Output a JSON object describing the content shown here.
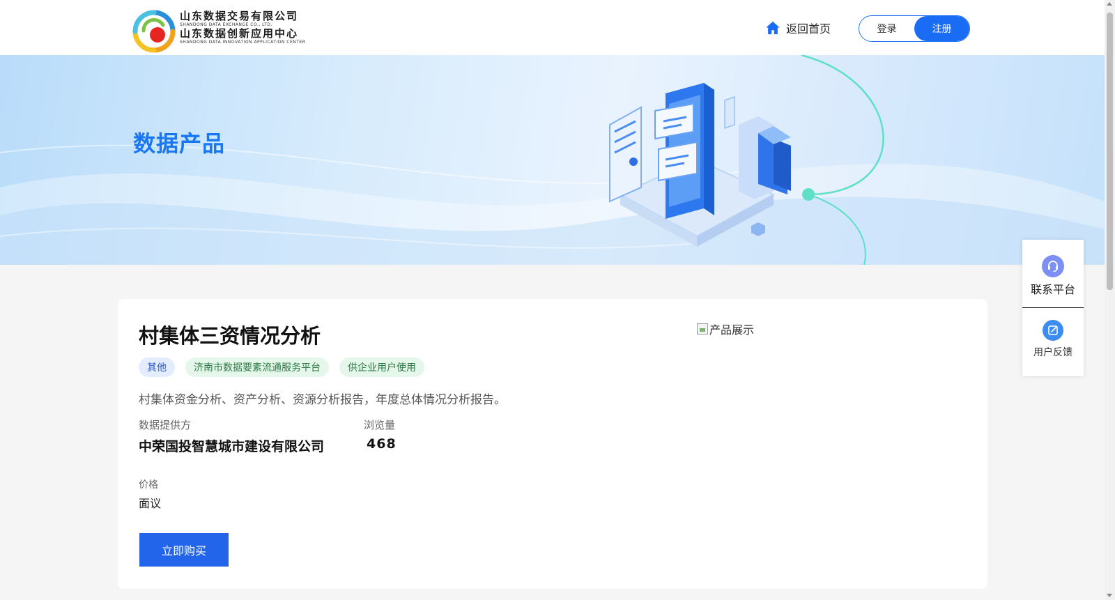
{
  "header": {
    "logo": {
      "line1_cn": "山东数据交易有限公司",
      "line1_en": "SHANDONG DATA EXCHANGE CO., LTD.",
      "line2_cn": "山东数据创新应用中心",
      "line2_en": "SHANDONG DATA INNOVATION APPLICATION CENTER"
    },
    "home_label": "返回首页",
    "login_label": "登录",
    "register_label": "注册"
  },
  "banner": {
    "title": "数据产品"
  },
  "product": {
    "title": "村集体三资情况分析",
    "tags": [
      "其他",
      "济南市数据要素流通服务平台",
      "供企业用户使用"
    ],
    "description": "村集体资金分析、资产分析、资源分析报告，年度总体情况分析报告。",
    "provider_label": "数据提供方",
    "provider_value": "中荣国投智慧城市建设有限公司",
    "views_label": "浏览量",
    "views_value": "468",
    "price_label": "价格",
    "price_value": "面议",
    "buy_label": "立即购买",
    "image_alt": "产品展示"
  },
  "side_panel": {
    "contact_label": "联系平台",
    "feedback_label": "用户反馈"
  },
  "colors": {
    "primary": "#1a6cf4",
    "title_blue": "#1877f2",
    "buy_button": "#2265eb"
  }
}
